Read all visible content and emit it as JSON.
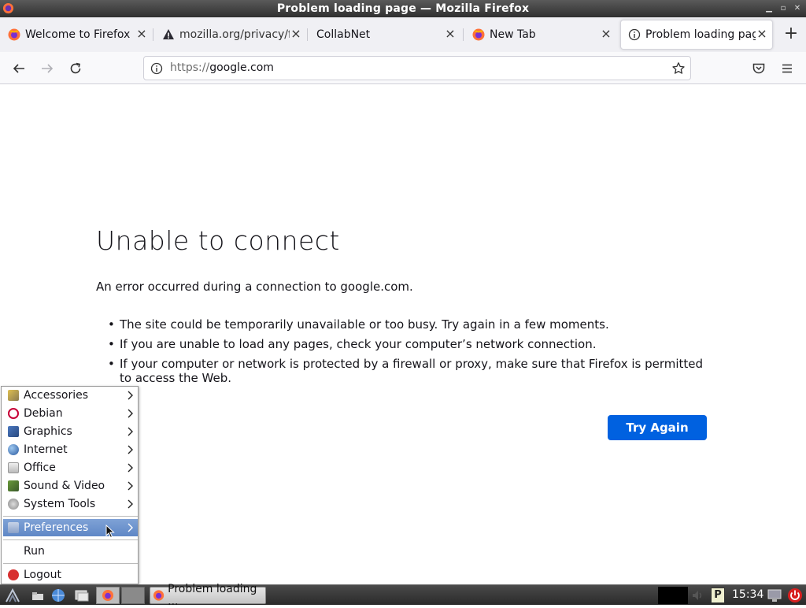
{
  "window": {
    "title": "Problem loading page — Mozilla Firefox"
  },
  "tabs": [
    {
      "label": "Welcome to Firefox",
      "icon": "firefox-icon",
      "active": false
    },
    {
      "label": "mozilla.org/privacy/fi",
      "icon": "warning-icon",
      "active": false
    },
    {
      "label": "CollabNet",
      "icon": "",
      "active": false
    },
    {
      "label": "New Tab",
      "icon": "firefox-icon",
      "active": false
    },
    {
      "label": "Problem loading page",
      "icon": "info-icon",
      "active": true
    }
  ],
  "urlbar": {
    "scheme": "https://",
    "host": "google.com"
  },
  "error": {
    "title": "Unable to connect",
    "description": "An error occurred during a connection to google.com.",
    "bullets": [
      "The site could be temporarily unavailable or too busy. Try again in a few moments.",
      "If you are unable to load any pages, check your computer’s network connection.",
      "If your computer or network is protected by a firewall or proxy, make sure that Firefox is permitted to access the Web."
    ],
    "button": "Try Again"
  },
  "start_menu": {
    "items": [
      {
        "label": "Accessories",
        "icon": "accessories-icon",
        "submenu": true
      },
      {
        "label": "Debian",
        "icon": "debian-icon",
        "submenu": true
      },
      {
        "label": "Graphics",
        "icon": "graphics-icon",
        "submenu": true
      },
      {
        "label": "Internet",
        "icon": "internet-icon",
        "submenu": true
      },
      {
        "label": "Office",
        "icon": "office-icon",
        "submenu": true
      },
      {
        "label": "Sound & Video",
        "icon": "sound-video-icon",
        "submenu": true
      },
      {
        "label": "System Tools",
        "icon": "system-tools-icon",
        "submenu": true
      }
    ],
    "preferences": {
      "label": "Preferences",
      "icon": "preferences-icon",
      "highlighted": true
    },
    "run": {
      "label": "Run"
    },
    "logout": {
      "label": "Logout",
      "icon": "logout-icon"
    }
  },
  "taskbar": {
    "task_label": "Problem loading ...",
    "clock": "15:34"
  },
  "colors": {
    "accent": "#0061e0",
    "menu_highlight": "#6a8fcc"
  }
}
